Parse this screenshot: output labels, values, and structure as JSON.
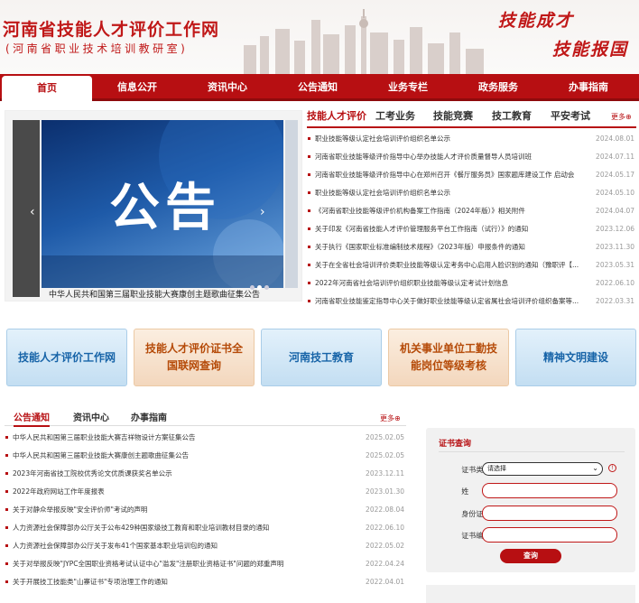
{
  "header": {
    "title": "河南省技能人才评价工作网",
    "subtitle": "(河南省职业技术培训教研室)",
    "slogan_1": "技能成才",
    "slogan_2": "技能报国"
  },
  "nav": {
    "items": [
      "首页",
      "信息公开",
      "资讯中心",
      "公告通知",
      "业务专栏",
      "政务服务",
      "办事指南"
    ]
  },
  "slider": {
    "image_text": "公告",
    "caption": "中华人民共和国第三届职业技能大赛康创主题歌曲征集公告",
    "prev": "‹",
    "next": "›"
  },
  "news_tabs": {
    "items": [
      "技能人才评价",
      "工考业务",
      "技能竞赛",
      "技工教育",
      "平安考试"
    ],
    "more": "更多⊕"
  },
  "news": [
    {
      "title": "职业技能等级认定社会培训评价组织名单公示",
      "date": "2024.08.01"
    },
    {
      "title": "河南省职业技能等级评价指导中心举办技能人才评价质量督导人员培训班",
      "date": "2024.07.11"
    },
    {
      "title": "河南省职业技能等级评价指导中心在郑州召开《餐厅服务员》国家题库建设工作 启动会",
      "date": "2024.05.17"
    },
    {
      "title": "职业技能等级认定社会培训评价组织名单公示",
      "date": "2024.05.10"
    },
    {
      "title": "《河南省职业技能等级评价机构备案工作指南（2024年版）》相关附件",
      "date": "2024.04.07"
    },
    {
      "title": "关于印发《河南省技能人才评价管理服务平台工作指南（试行）》的通知",
      "date": "2023.12.06"
    },
    {
      "title": "关于执行《国家职业标准编制技术规程》（2023年版）申报条件的通知",
      "date": "2023.11.30"
    },
    {
      "title": "关于在全省社会培训评价类职业技能等级认定考务中心启用人脸识别的通知（豫职评【...",
      "date": "2023.05.31"
    },
    {
      "title": "2022年河南省社会培训评价组织职业技能等级认定考试计划信息",
      "date": "2022.06.10"
    },
    {
      "title": "河南省职业技能鉴定指导中心关于做好职业技能等级认定省属社会培训评价组织备案等...",
      "date": "2022.03.31"
    }
  ],
  "tiles": [
    {
      "label": "技能人才评价工作网",
      "style": "blue"
    },
    {
      "label": "技能人才评价证书全国联网查询",
      "style": "orange"
    },
    {
      "label": "河南技工教育",
      "style": "blue"
    },
    {
      "label": "机关事业单位工勤技能岗位等级考核",
      "style": "orange"
    },
    {
      "label": "精神文明建设",
      "style": "blue"
    }
  ],
  "bottom_tabs": {
    "items": [
      "公告通知",
      "资讯中心",
      "办事指南"
    ],
    "more": "更多⊕"
  },
  "bottom_news": [
    {
      "title": "中华人民共和国第三届职业技能大赛吉祥物设计方案征集公告",
      "date": "2025.02.05"
    },
    {
      "title": "中华人民共和国第三届职业技能大赛康创主题歌曲征集公告",
      "date": "2025.02.05"
    },
    {
      "title": "2023年河南省技工院校优秀论文优质课获奖名单公示",
      "date": "2023.12.11"
    },
    {
      "title": "2022年政府网站工作年度报表",
      "date": "2023.01.30"
    },
    {
      "title": "关于对静众举报反映\"安全评价师\"考试的声明",
      "date": "2022.08.04"
    },
    {
      "title": "人力资源社会保障部办公厅关于公布429种国家级技工教育和职业培训教材目录的通知",
      "date": "2022.06.10"
    },
    {
      "title": "人力资源社会保障部办公厅关于发布41个国家基本职业培训包的通知",
      "date": "2022.05.02"
    },
    {
      "title": "关于对举报反映\"JYPC全国职业资格考试认证中心\"滥发\"注册职业资格证书\"问题的郑重声明",
      "date": "2022.04.24"
    },
    {
      "title": "关于开展技工技能类\"山寨证书\"专项治理工作的通知",
      "date": "2022.04.01"
    }
  ],
  "cert": {
    "title": "证书查询",
    "type_label": "证书类型:",
    "type_value": "请选择",
    "name_label": "姓　　名:",
    "id_label": "身份证号:",
    "num_label": "证书编号:",
    "button": "查询",
    "info": "!"
  },
  "colors": {
    "brand": "#b70f12",
    "tile_blue": "#1764a8",
    "tile_orange": "#b54a08"
  }
}
